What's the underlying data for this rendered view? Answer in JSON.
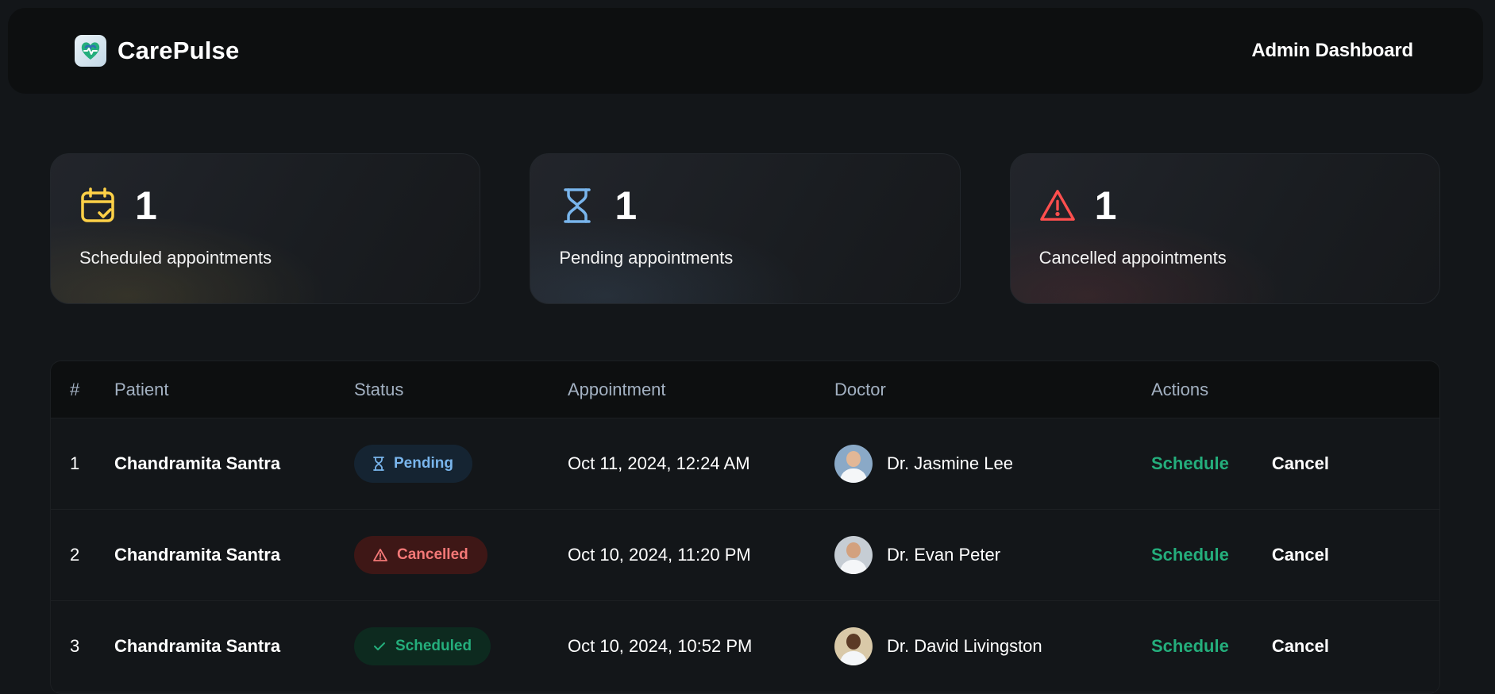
{
  "header": {
    "brand": "CarePulse",
    "title": "Admin Dashboard",
    "logo_icon": "heart-pulse-icon"
  },
  "stats": [
    {
      "count": "1",
      "label": "Scheduled appointments",
      "icon": "calendar-check-icon",
      "color": "#FFD147"
    },
    {
      "count": "1",
      "label": "Pending appointments",
      "icon": "hourglass-icon",
      "color": "#79B5EC"
    },
    {
      "count": "1",
      "label": "Cancelled appointments",
      "icon": "alert-triangle-icon",
      "color": "#FF4F4E"
    }
  ],
  "table": {
    "headers": [
      "#",
      "Patient",
      "Status",
      "Appointment",
      "Doctor",
      "Actions"
    ],
    "rows": [
      {
        "num": "1",
        "patient": "Chandramita Santra",
        "status": "Pending",
        "appointment": "Oct 11, 2024, 12:24 AM",
        "doctor": "Dr. Jasmine Lee",
        "schedule": "Schedule",
        "cancel": "Cancel"
      },
      {
        "num": "2",
        "patient": "Chandramita Santra",
        "status": "Cancelled",
        "appointment": "Oct 10, 2024, 11:20 PM",
        "doctor": "Dr. Evan Peter",
        "schedule": "Schedule",
        "cancel": "Cancel"
      },
      {
        "num": "3",
        "patient": "Chandramita Santra",
        "status": "Scheduled",
        "appointment": "Oct 10, 2024, 10:52 PM",
        "doctor": "Dr. David Livingston",
        "schedule": "Schedule",
        "cancel": "Cancel"
      }
    ]
  },
  "colors": {
    "background": "#131619",
    "header_bg": "#0D0F10",
    "scheduled": "#24AE7C",
    "pending": "#79B5EC",
    "cancelled": "#F37877",
    "scheduled_stat": "#FFD147"
  }
}
